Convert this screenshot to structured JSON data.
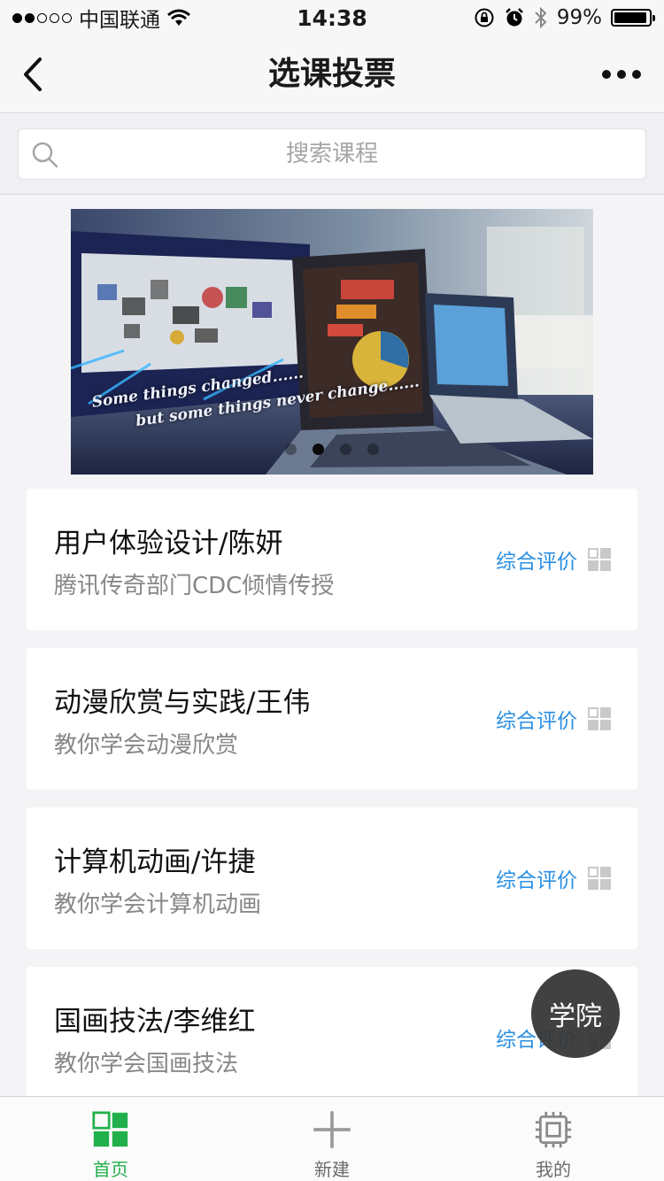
{
  "status_bar": {
    "carrier": "中国联通",
    "time": "14:38",
    "battery_text": "99%",
    "battery_level": 0.99,
    "signal_strength": 2
  },
  "nav": {
    "title": "选课投票",
    "back_icon": "chevron-left-icon",
    "more_icon": "more-dots-icon"
  },
  "search": {
    "placeholder": "搜索课程",
    "value": "",
    "icon": "search-icon"
  },
  "banner": {
    "caption_line1": "Some things changed......",
    "caption_line2": "but some things never change......",
    "slide_count": 4,
    "active_index": 1
  },
  "courses": [
    {
      "title": "用户体验设计/陈妍",
      "desc": "腾讯传奇部门CDC倾情传授",
      "action": "综合评价"
    },
    {
      "title": "动漫欣赏与实践/王伟",
      "desc": "教你学会动漫欣赏",
      "action": "综合评价"
    },
    {
      "title": "计算机动画/许捷",
      "desc": "教你学会计算机动画",
      "action": "综合评价"
    },
    {
      "title": "国画技法/李维红",
      "desc": "教你学会国画技法",
      "action": "综合评价"
    }
  ],
  "floating_button": {
    "label": "学院"
  },
  "tab_bar": [
    {
      "label": "首页",
      "icon": "home-grid-icon",
      "active": true
    },
    {
      "label": "新建",
      "icon": "plus-icon",
      "active": false
    },
    {
      "label": "我的",
      "icon": "chip-icon",
      "active": false
    }
  ],
  "colors": {
    "accent_green": "#21b04b",
    "link_blue": "#2b8fe3",
    "background": "#f4f4f6"
  }
}
